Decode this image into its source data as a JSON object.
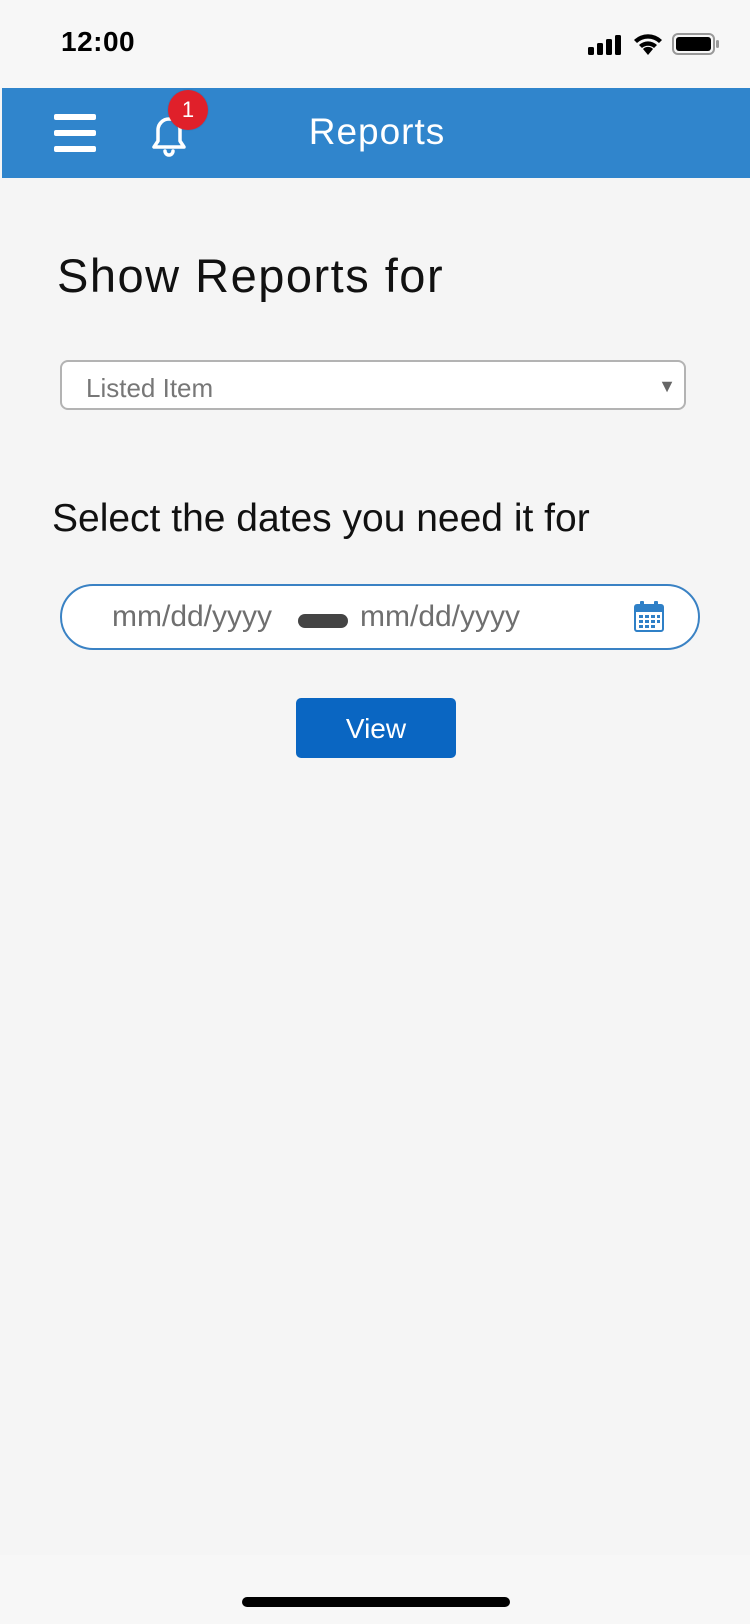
{
  "status_bar": {
    "time": "12:00"
  },
  "header": {
    "title": "Reports",
    "notification_count": "1",
    "background_color": "#3085cc",
    "icons": [
      "menu-icon",
      "bell-icon"
    ]
  },
  "reports_filter": {
    "title": "Show Reports for",
    "select": {
      "value": "Listed Item"
    }
  },
  "date_filter": {
    "label": "Select the dates you need it for",
    "start_placeholder": "mm/dd/yyyy",
    "end_placeholder": "mm/dd/yyyy",
    "icon": "calendar-icon"
  },
  "actions": {
    "view_label": "View",
    "button_color": "#0a66c2"
  }
}
